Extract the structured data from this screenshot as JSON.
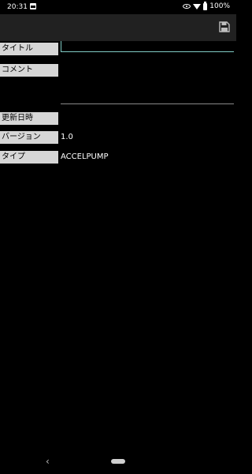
{
  "status_bar": {
    "time": "20:31",
    "battery": "100%",
    "icons": [
      "image-notification-icon",
      "eye-icon",
      "wifi-icon",
      "battery-icon"
    ]
  },
  "app_bar": {
    "save_icon": "save-icon"
  },
  "form": {
    "title_label": "タイトル",
    "title_value": "",
    "comment_label": "コメント",
    "comment_value": "",
    "updated_label": "更新日時",
    "updated_value": "",
    "version_label": "バージョン",
    "version_value": "1.0",
    "type_label": "タイプ",
    "type_value": "ACCELPUMP"
  },
  "nav_bar": {
    "back_icon": "back-icon",
    "home_icon": "home-pill-icon"
  },
  "colors": {
    "background": "#000000",
    "app_bar": "#212121",
    "label_bg": "#d6d6d6",
    "accent": "#80cbc4"
  }
}
